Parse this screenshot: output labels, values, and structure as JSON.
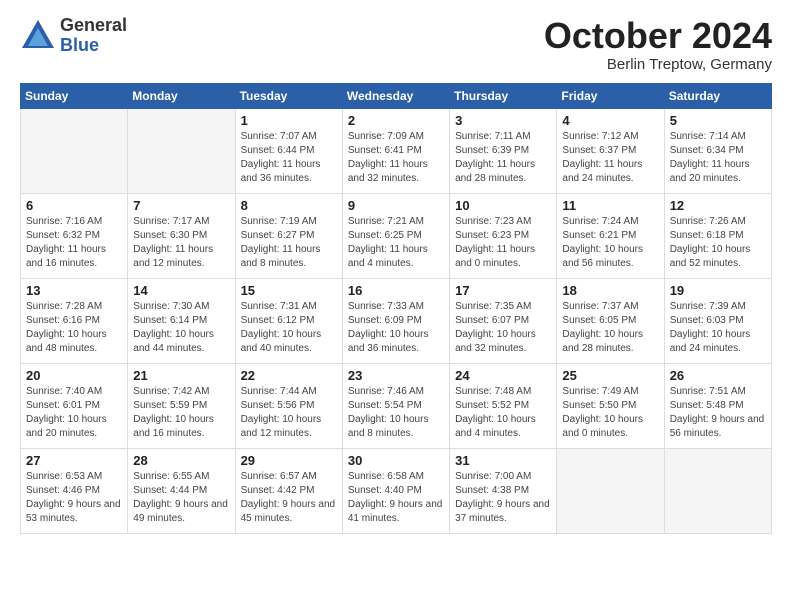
{
  "header": {
    "logo_general": "General",
    "logo_blue": "Blue",
    "month_title": "October 2024",
    "location": "Berlin Treptow, Germany"
  },
  "days_of_week": [
    "Sunday",
    "Monday",
    "Tuesday",
    "Wednesday",
    "Thursday",
    "Friday",
    "Saturday"
  ],
  "weeks": [
    [
      {
        "day": "",
        "info": ""
      },
      {
        "day": "",
        "info": ""
      },
      {
        "day": "1",
        "info": "Sunrise: 7:07 AM\nSunset: 6:44 PM\nDaylight: 11 hours and 36 minutes."
      },
      {
        "day": "2",
        "info": "Sunrise: 7:09 AM\nSunset: 6:41 PM\nDaylight: 11 hours and 32 minutes."
      },
      {
        "day": "3",
        "info": "Sunrise: 7:11 AM\nSunset: 6:39 PM\nDaylight: 11 hours and 28 minutes."
      },
      {
        "day": "4",
        "info": "Sunrise: 7:12 AM\nSunset: 6:37 PM\nDaylight: 11 hours and 24 minutes."
      },
      {
        "day": "5",
        "info": "Sunrise: 7:14 AM\nSunset: 6:34 PM\nDaylight: 11 hours and 20 minutes."
      }
    ],
    [
      {
        "day": "6",
        "info": "Sunrise: 7:16 AM\nSunset: 6:32 PM\nDaylight: 11 hours and 16 minutes."
      },
      {
        "day": "7",
        "info": "Sunrise: 7:17 AM\nSunset: 6:30 PM\nDaylight: 11 hours and 12 minutes."
      },
      {
        "day": "8",
        "info": "Sunrise: 7:19 AM\nSunset: 6:27 PM\nDaylight: 11 hours and 8 minutes."
      },
      {
        "day": "9",
        "info": "Sunrise: 7:21 AM\nSunset: 6:25 PM\nDaylight: 11 hours and 4 minutes."
      },
      {
        "day": "10",
        "info": "Sunrise: 7:23 AM\nSunset: 6:23 PM\nDaylight: 11 hours and 0 minutes."
      },
      {
        "day": "11",
        "info": "Sunrise: 7:24 AM\nSunset: 6:21 PM\nDaylight: 10 hours and 56 minutes."
      },
      {
        "day": "12",
        "info": "Sunrise: 7:26 AM\nSunset: 6:18 PM\nDaylight: 10 hours and 52 minutes."
      }
    ],
    [
      {
        "day": "13",
        "info": "Sunrise: 7:28 AM\nSunset: 6:16 PM\nDaylight: 10 hours and 48 minutes."
      },
      {
        "day": "14",
        "info": "Sunrise: 7:30 AM\nSunset: 6:14 PM\nDaylight: 10 hours and 44 minutes."
      },
      {
        "day": "15",
        "info": "Sunrise: 7:31 AM\nSunset: 6:12 PM\nDaylight: 10 hours and 40 minutes."
      },
      {
        "day": "16",
        "info": "Sunrise: 7:33 AM\nSunset: 6:09 PM\nDaylight: 10 hours and 36 minutes."
      },
      {
        "day": "17",
        "info": "Sunrise: 7:35 AM\nSunset: 6:07 PM\nDaylight: 10 hours and 32 minutes."
      },
      {
        "day": "18",
        "info": "Sunrise: 7:37 AM\nSunset: 6:05 PM\nDaylight: 10 hours and 28 minutes."
      },
      {
        "day": "19",
        "info": "Sunrise: 7:39 AM\nSunset: 6:03 PM\nDaylight: 10 hours and 24 minutes."
      }
    ],
    [
      {
        "day": "20",
        "info": "Sunrise: 7:40 AM\nSunset: 6:01 PM\nDaylight: 10 hours and 20 minutes."
      },
      {
        "day": "21",
        "info": "Sunrise: 7:42 AM\nSunset: 5:59 PM\nDaylight: 10 hours and 16 minutes."
      },
      {
        "day": "22",
        "info": "Sunrise: 7:44 AM\nSunset: 5:56 PM\nDaylight: 10 hours and 12 minutes."
      },
      {
        "day": "23",
        "info": "Sunrise: 7:46 AM\nSunset: 5:54 PM\nDaylight: 10 hours and 8 minutes."
      },
      {
        "day": "24",
        "info": "Sunrise: 7:48 AM\nSunset: 5:52 PM\nDaylight: 10 hours and 4 minutes."
      },
      {
        "day": "25",
        "info": "Sunrise: 7:49 AM\nSunset: 5:50 PM\nDaylight: 10 hours and 0 minutes."
      },
      {
        "day": "26",
        "info": "Sunrise: 7:51 AM\nSunset: 5:48 PM\nDaylight: 9 hours and 56 minutes."
      }
    ],
    [
      {
        "day": "27",
        "info": "Sunrise: 6:53 AM\nSunset: 4:46 PM\nDaylight: 9 hours and 53 minutes."
      },
      {
        "day": "28",
        "info": "Sunrise: 6:55 AM\nSunset: 4:44 PM\nDaylight: 9 hours and 49 minutes."
      },
      {
        "day": "29",
        "info": "Sunrise: 6:57 AM\nSunset: 4:42 PM\nDaylight: 9 hours and 45 minutes."
      },
      {
        "day": "30",
        "info": "Sunrise: 6:58 AM\nSunset: 4:40 PM\nDaylight: 9 hours and 41 minutes."
      },
      {
        "day": "31",
        "info": "Sunrise: 7:00 AM\nSunset: 4:38 PM\nDaylight: 9 hours and 37 minutes."
      },
      {
        "day": "",
        "info": ""
      },
      {
        "day": "",
        "info": ""
      }
    ]
  ]
}
